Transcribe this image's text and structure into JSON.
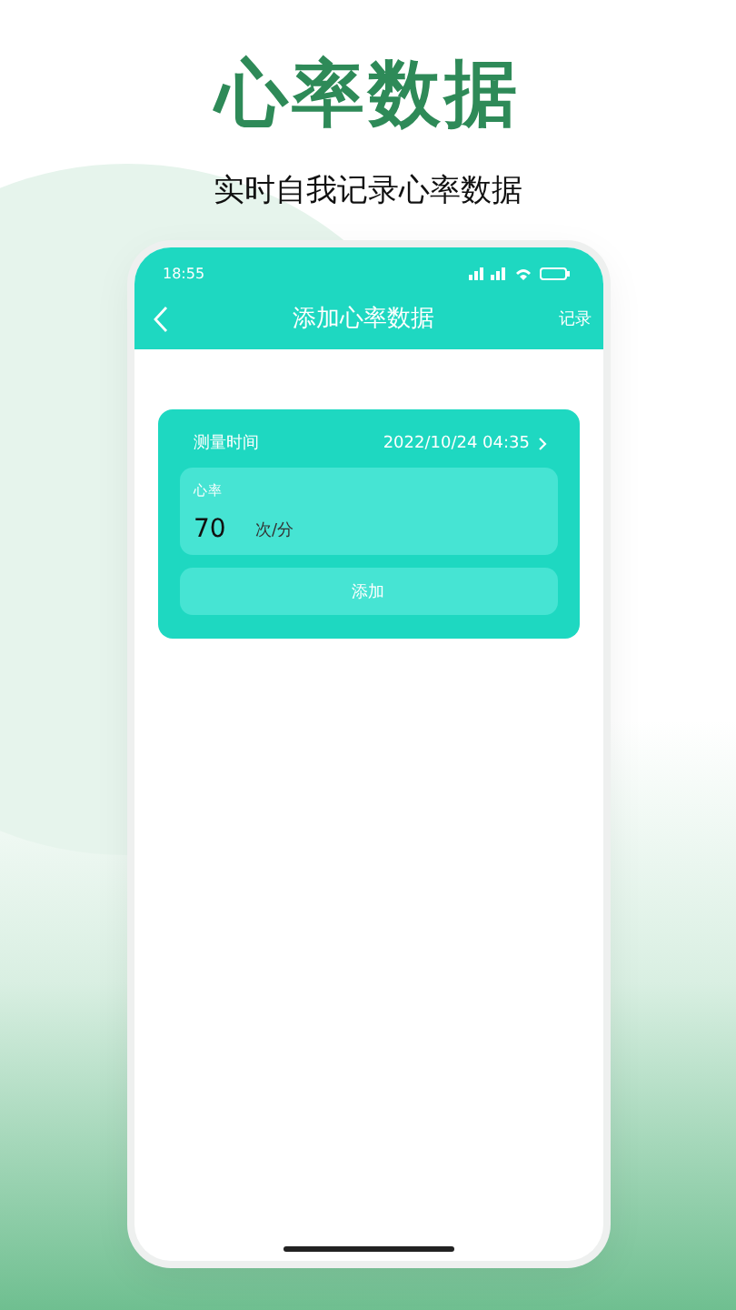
{
  "header": {
    "title": "心率数据",
    "subtitle": "实时自我记录心率数据"
  },
  "status_bar": {
    "time": "18:55"
  },
  "nav": {
    "title": "添加心率数据",
    "action": "记录"
  },
  "form": {
    "time_label": "测量时间",
    "time_value": "2022/10/24 04:35",
    "heart_rate_label": "心率",
    "heart_rate_value": "70",
    "unit": "次/分",
    "submit": "添加"
  }
}
